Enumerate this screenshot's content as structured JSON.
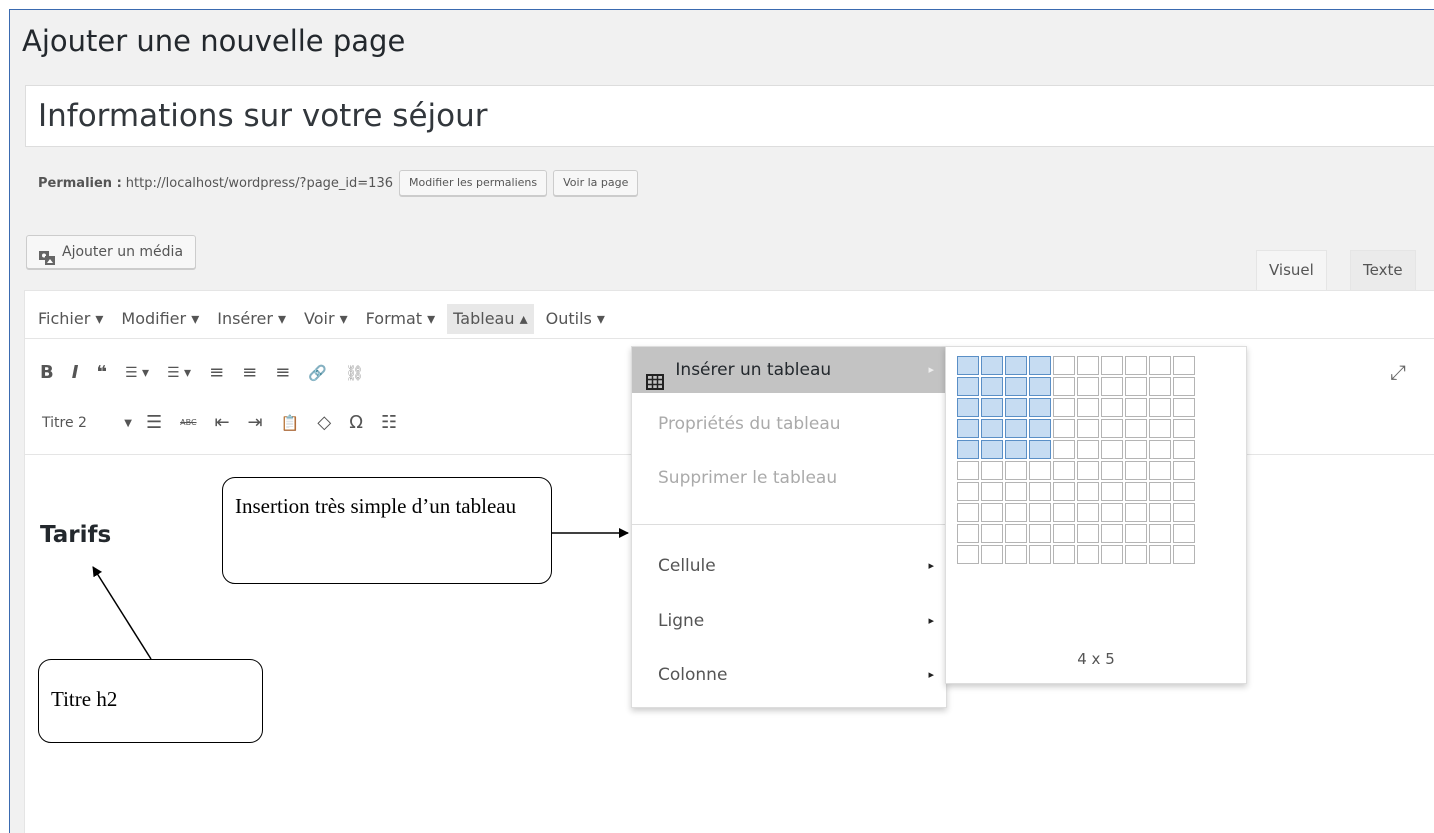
{
  "page": {
    "heading": "Ajouter une nouvelle page"
  },
  "post": {
    "title": "Informations sur votre séjour"
  },
  "permalink": {
    "label": "Permalien :",
    "url": "http://localhost/wordpress/?page_id=136",
    "edit_button": "Modifier les permaliens",
    "view_button": "Voir la page"
  },
  "media": {
    "button_label": "Ajouter un média"
  },
  "editor_tabs": {
    "visual": "Visuel",
    "text": "Texte"
  },
  "menubar": {
    "items": [
      {
        "label": "Fichier ▾"
      },
      {
        "label": "Modifier ▾"
      },
      {
        "label": "Insérer ▾"
      },
      {
        "label": "Voir ▾"
      },
      {
        "label": "Format ▾"
      },
      {
        "label": "Tableau ▴",
        "active": true
      },
      {
        "label": "Outils ▾"
      }
    ]
  },
  "toolbar": {
    "row1": {
      "bold": "B",
      "italic": "I",
      "quote": "❝",
      "bullets": "☰ ▾",
      "numbers": "☰ ▾",
      "align_left": "≡",
      "align_center": "≡",
      "align_right": "≡",
      "link": "🔗",
      "unlink": "⛓",
      "fullscreen": "⤢"
    },
    "row2": {
      "format_value": "Titre 2",
      "format_arrow": "▼",
      "hr": "☰",
      "strike": "ABC",
      "outdent": "⇤",
      "indent": "⇥",
      "paste": "📋",
      "clear": "◇",
      "omega": "Ω",
      "more": "☷"
    }
  },
  "content": {
    "h2_text": "Tarifs"
  },
  "table_menu": {
    "items": [
      {
        "label": "Insérer un tableau",
        "highlighted": true,
        "submenu": true
      },
      {
        "label": "Propriétés du tableau",
        "disabled": true
      },
      {
        "label": "Supprimer le tableau",
        "disabled": true
      },
      {
        "label": "Cellule",
        "submenu": true
      },
      {
        "label": "Ligne",
        "submenu": true
      },
      {
        "label": "Colonne",
        "submenu": true
      }
    ],
    "submenu_arrow": "▸"
  },
  "table_grid": {
    "columns": 10,
    "rows": 10,
    "selected_cols": 4,
    "selected_rows": 5,
    "size_label": "4 x 5"
  },
  "annotations": {
    "callout_table": "Insertion très simple d’un tableau",
    "callout_h2": "Titre h2"
  }
}
